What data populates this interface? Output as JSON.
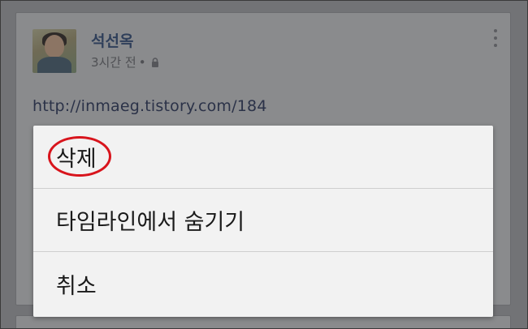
{
  "post": {
    "author": "석선옥",
    "time": "3시간 전",
    "separator": "•",
    "link": "http://inmaeg.tistory.com/184",
    "privacy_icon": "lock-icon",
    "more_icon": "more-vertical-icon"
  },
  "menu": {
    "items": [
      {
        "label": "삭제",
        "highlighted": true
      },
      {
        "label": "타임라인에서 숨기기"
      },
      {
        "label": "취소"
      }
    ],
    "highlight_color": "#d8141c"
  }
}
